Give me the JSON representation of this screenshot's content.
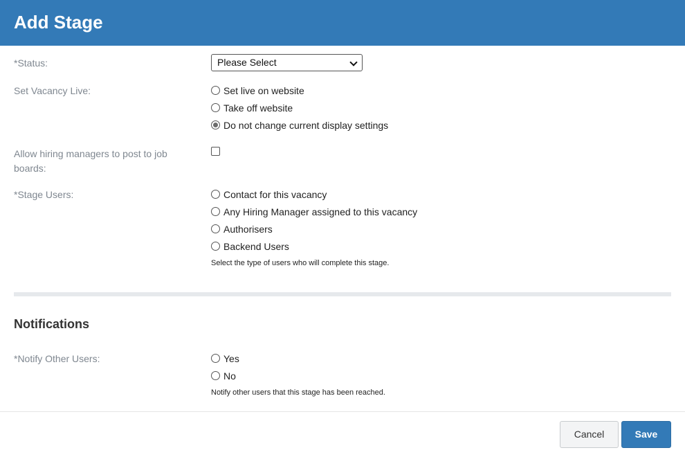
{
  "dialog": {
    "title": "Add Stage"
  },
  "status": {
    "label": "*Status:",
    "selected": "Please Select"
  },
  "vacancy_live": {
    "label": "Set Vacancy Live:",
    "options": [
      {
        "label": "Set live on website",
        "checked": false
      },
      {
        "label": "Take off website",
        "checked": false
      },
      {
        "label": "Do not change current display settings",
        "checked": true
      }
    ]
  },
  "hiring_managers": {
    "label": "Allow hiring managers to post to job boards:",
    "checked": false
  },
  "stage_users": {
    "label": "*Stage Users:",
    "options": [
      {
        "label": "Contact for this vacancy",
        "checked": false
      },
      {
        "label": "Any Hiring Manager assigned to this vacancy",
        "checked": false
      },
      {
        "label": "Authorisers",
        "checked": false
      },
      {
        "label": "Backend Users",
        "checked": false
      }
    ],
    "help": "Select the type of users who will complete this stage."
  },
  "notifications": {
    "title": "Notifications",
    "notify_label": "*Notify Other Users:",
    "options": [
      {
        "label": "Yes",
        "checked": false
      },
      {
        "label": "No",
        "checked": false
      }
    ],
    "help": "Notify other users that this stage has been reached."
  },
  "footer": {
    "cancel_label": "Cancel",
    "save_label": "Save"
  },
  "colors": {
    "header": "#337ab7",
    "save_button": "#337ab7",
    "label_text": "#7f8790",
    "divider": "#e6e9ec"
  }
}
